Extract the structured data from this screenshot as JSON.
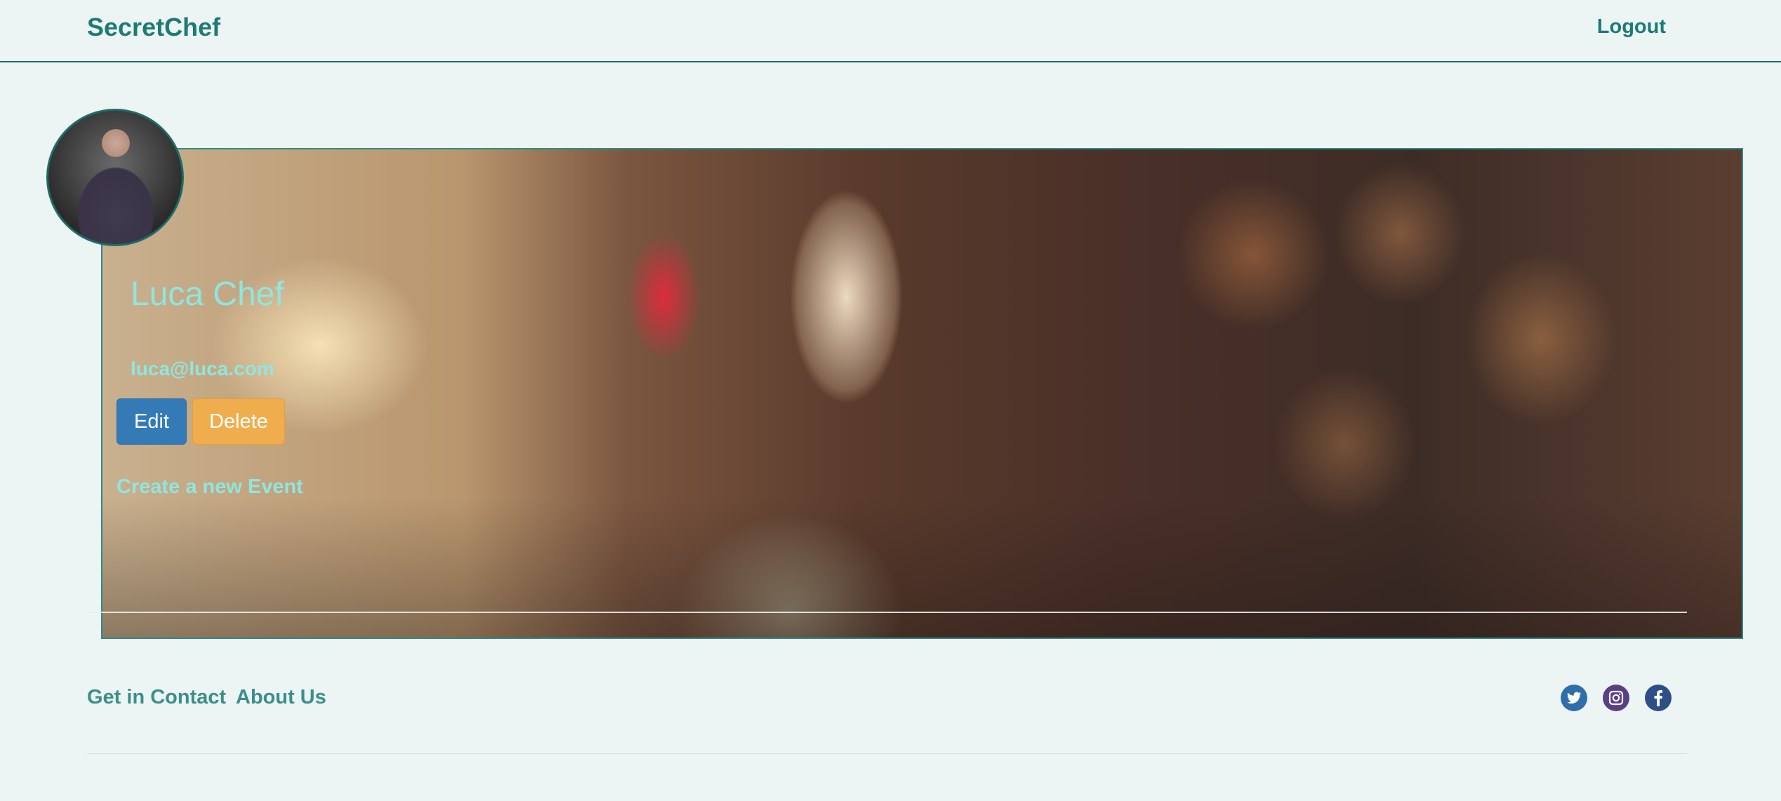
{
  "navbar": {
    "brand": "SecretChef",
    "logout_label": "Logout"
  },
  "profile": {
    "name": "Luca Chef",
    "email": "luca@luca.com",
    "edit_label": "Edit",
    "delete_label": "Delete",
    "create_event_label": "Create a new Event"
  },
  "footer": {
    "contact_label": "Get in Contact",
    "about_label": "About Us",
    "social": [
      "twitter-icon",
      "instagram-icon",
      "facebook-icon"
    ]
  },
  "colors": {
    "background": "#ecf5f4",
    "brand": "#1e7a75",
    "accent_text": "#8fe6e0",
    "edit_button": "#337ab7",
    "delete_button": "#efad4d"
  }
}
